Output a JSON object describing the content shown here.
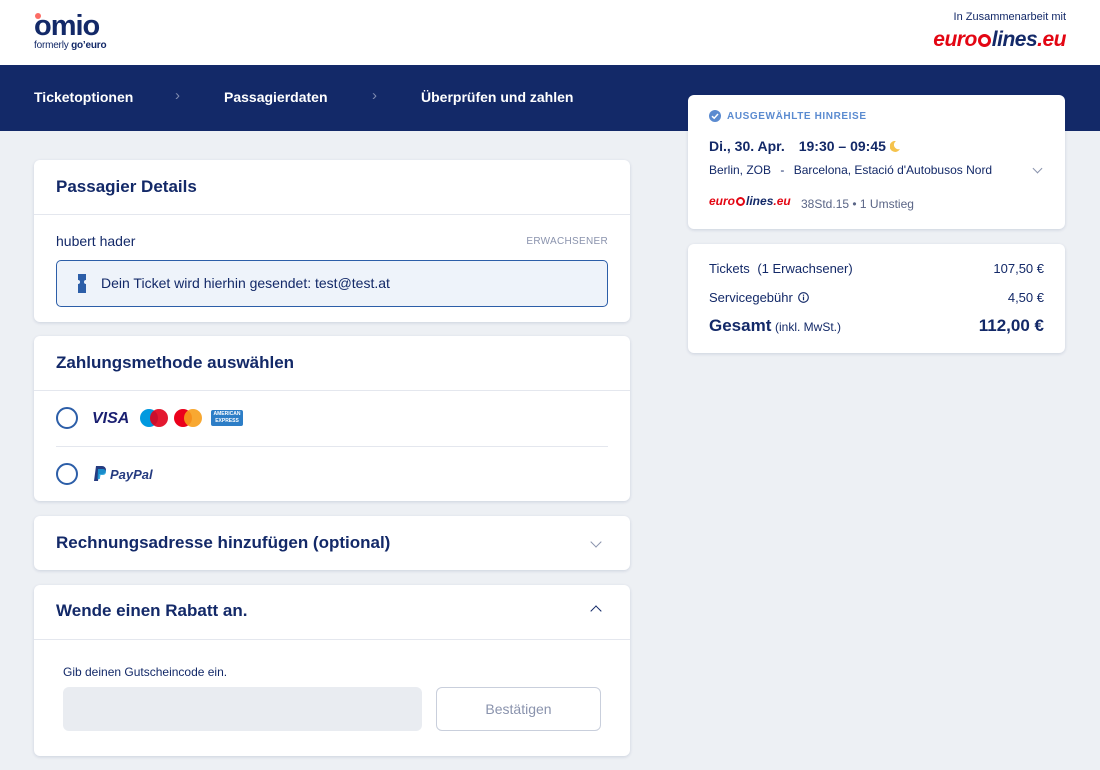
{
  "header": {
    "logo_text": "omio",
    "logo_sub_prefix": "formerly ",
    "logo_sub_brand": "go’euro",
    "partner_label": "In Zusammenarbeit mit",
    "partner_logo_text": "eurolines.eu"
  },
  "steps": [
    {
      "label": "Ticketoptionen"
    },
    {
      "label": "Passagierdaten"
    },
    {
      "label": "Überprüfen und zahlen"
    }
  ],
  "passenger": {
    "title": "Passagier Details",
    "name": "hubert hader",
    "type": "ERWACHSENER",
    "ticket_info": "Dein Ticket wird hierhin gesendet: test@test.at"
  },
  "payment": {
    "title": "Zahlungsmethode auswählen",
    "card_brands": [
      "VISA",
      "Maestro",
      "MasterCard",
      "American Express"
    ],
    "visa_label": "VISA",
    "amex_label": "AMERICAN EXPRESS",
    "paypal_label": "PayPal",
    "colors": {
      "maestro_blue": "#0099df",
      "maestro_red": "#e00019",
      "mastercard_red": "#eb001b",
      "mastercard_orange": "#f79e1b",
      "paypal_navy": "#253b80",
      "paypal_blue": "#179bd7",
      "amex_blue": "#2d7ec7"
    }
  },
  "billing": {
    "title": "Rechnungsadresse hinzufügen (optional)"
  },
  "discount": {
    "title": "Wende einen Rabatt an.",
    "input_label": "Gib deinen Gutscheincode ein.",
    "input_value": "",
    "confirm_label": "Bestätigen"
  },
  "trip": {
    "badge": "AUSGEWÄHLTE HINREISE",
    "date": "Di., 30. Apr.",
    "time": "19:30 – 09:45",
    "route_from": "Berlin, ZOB",
    "route_sep": "-",
    "route_to": "Barcelona, Estació d'Autobusos Nord",
    "carrier_logo": "eurolines.eu",
    "details": "38Std.15 • 1 Umstieg"
  },
  "prices": {
    "tickets_label": "Tickets",
    "tickets_count": "(1 Erwachsener)",
    "tickets_value": "107,50 €",
    "service_label": "Servicegebühr",
    "service_value": "4,50 €",
    "total_label": "Gesamt",
    "total_note": "(inkl. MwSt.)",
    "total_value": "112,00 €"
  },
  "colors": {
    "navy": "#132968",
    "background": "#edf0f4",
    "accent_blue": "#2c5ea8",
    "info_bg": "#eef3fa",
    "eurolines_red": "#e30613",
    "moon": "#f5c34d"
  }
}
